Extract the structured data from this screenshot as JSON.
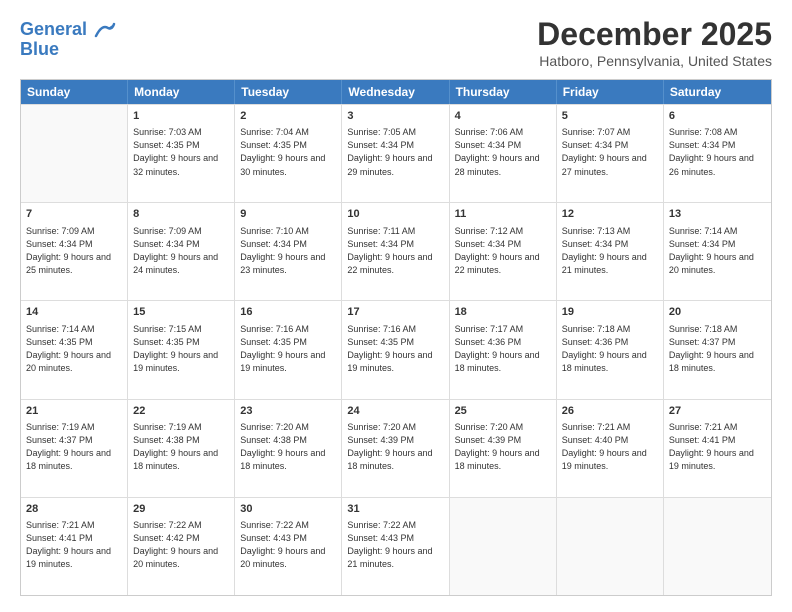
{
  "header": {
    "logo_line1": "General",
    "logo_line2": "Blue",
    "title": "December 2025",
    "subtitle": "Hatboro, Pennsylvania, United States"
  },
  "calendar": {
    "days_of_week": [
      "Sunday",
      "Monday",
      "Tuesday",
      "Wednesday",
      "Thursday",
      "Friday",
      "Saturday"
    ],
    "weeks": [
      [
        {
          "day": "",
          "sunrise": "",
          "sunset": "",
          "daylight": "",
          "empty": true
        },
        {
          "day": "1",
          "sunrise": "Sunrise: 7:03 AM",
          "sunset": "Sunset: 4:35 PM",
          "daylight": "Daylight: 9 hours and 32 minutes.",
          "empty": false
        },
        {
          "day": "2",
          "sunrise": "Sunrise: 7:04 AM",
          "sunset": "Sunset: 4:35 PM",
          "daylight": "Daylight: 9 hours and 30 minutes.",
          "empty": false
        },
        {
          "day": "3",
          "sunrise": "Sunrise: 7:05 AM",
          "sunset": "Sunset: 4:34 PM",
          "daylight": "Daylight: 9 hours and 29 minutes.",
          "empty": false
        },
        {
          "day": "4",
          "sunrise": "Sunrise: 7:06 AM",
          "sunset": "Sunset: 4:34 PM",
          "daylight": "Daylight: 9 hours and 28 minutes.",
          "empty": false
        },
        {
          "day": "5",
          "sunrise": "Sunrise: 7:07 AM",
          "sunset": "Sunset: 4:34 PM",
          "daylight": "Daylight: 9 hours and 27 minutes.",
          "empty": false
        },
        {
          "day": "6",
          "sunrise": "Sunrise: 7:08 AM",
          "sunset": "Sunset: 4:34 PM",
          "daylight": "Daylight: 9 hours and 26 minutes.",
          "empty": false
        }
      ],
      [
        {
          "day": "7",
          "sunrise": "Sunrise: 7:09 AM",
          "sunset": "Sunset: 4:34 PM",
          "daylight": "Daylight: 9 hours and 25 minutes.",
          "empty": false
        },
        {
          "day": "8",
          "sunrise": "Sunrise: 7:09 AM",
          "sunset": "Sunset: 4:34 PM",
          "daylight": "Daylight: 9 hours and 24 minutes.",
          "empty": false
        },
        {
          "day": "9",
          "sunrise": "Sunrise: 7:10 AM",
          "sunset": "Sunset: 4:34 PM",
          "daylight": "Daylight: 9 hours and 23 minutes.",
          "empty": false
        },
        {
          "day": "10",
          "sunrise": "Sunrise: 7:11 AM",
          "sunset": "Sunset: 4:34 PM",
          "daylight": "Daylight: 9 hours and 22 minutes.",
          "empty": false
        },
        {
          "day": "11",
          "sunrise": "Sunrise: 7:12 AM",
          "sunset": "Sunset: 4:34 PM",
          "daylight": "Daylight: 9 hours and 22 minutes.",
          "empty": false
        },
        {
          "day": "12",
          "sunrise": "Sunrise: 7:13 AM",
          "sunset": "Sunset: 4:34 PM",
          "daylight": "Daylight: 9 hours and 21 minutes.",
          "empty": false
        },
        {
          "day": "13",
          "sunrise": "Sunrise: 7:14 AM",
          "sunset": "Sunset: 4:34 PM",
          "daylight": "Daylight: 9 hours and 20 minutes.",
          "empty": false
        }
      ],
      [
        {
          "day": "14",
          "sunrise": "Sunrise: 7:14 AM",
          "sunset": "Sunset: 4:35 PM",
          "daylight": "Daylight: 9 hours and 20 minutes.",
          "empty": false
        },
        {
          "day": "15",
          "sunrise": "Sunrise: 7:15 AM",
          "sunset": "Sunset: 4:35 PM",
          "daylight": "Daylight: 9 hours and 19 minutes.",
          "empty": false
        },
        {
          "day": "16",
          "sunrise": "Sunrise: 7:16 AM",
          "sunset": "Sunset: 4:35 PM",
          "daylight": "Daylight: 9 hours and 19 minutes.",
          "empty": false
        },
        {
          "day": "17",
          "sunrise": "Sunrise: 7:16 AM",
          "sunset": "Sunset: 4:35 PM",
          "daylight": "Daylight: 9 hours and 19 minutes.",
          "empty": false
        },
        {
          "day": "18",
          "sunrise": "Sunrise: 7:17 AM",
          "sunset": "Sunset: 4:36 PM",
          "daylight": "Daylight: 9 hours and 18 minutes.",
          "empty": false
        },
        {
          "day": "19",
          "sunrise": "Sunrise: 7:18 AM",
          "sunset": "Sunset: 4:36 PM",
          "daylight": "Daylight: 9 hours and 18 minutes.",
          "empty": false
        },
        {
          "day": "20",
          "sunrise": "Sunrise: 7:18 AM",
          "sunset": "Sunset: 4:37 PM",
          "daylight": "Daylight: 9 hours and 18 minutes.",
          "empty": false
        }
      ],
      [
        {
          "day": "21",
          "sunrise": "Sunrise: 7:19 AM",
          "sunset": "Sunset: 4:37 PM",
          "daylight": "Daylight: 9 hours and 18 minutes.",
          "empty": false
        },
        {
          "day": "22",
          "sunrise": "Sunrise: 7:19 AM",
          "sunset": "Sunset: 4:38 PM",
          "daylight": "Daylight: 9 hours and 18 minutes.",
          "empty": false
        },
        {
          "day": "23",
          "sunrise": "Sunrise: 7:20 AM",
          "sunset": "Sunset: 4:38 PM",
          "daylight": "Daylight: 9 hours and 18 minutes.",
          "empty": false
        },
        {
          "day": "24",
          "sunrise": "Sunrise: 7:20 AM",
          "sunset": "Sunset: 4:39 PM",
          "daylight": "Daylight: 9 hours and 18 minutes.",
          "empty": false
        },
        {
          "day": "25",
          "sunrise": "Sunrise: 7:20 AM",
          "sunset": "Sunset: 4:39 PM",
          "daylight": "Daylight: 9 hours and 18 minutes.",
          "empty": false
        },
        {
          "day": "26",
          "sunrise": "Sunrise: 7:21 AM",
          "sunset": "Sunset: 4:40 PM",
          "daylight": "Daylight: 9 hours and 19 minutes.",
          "empty": false
        },
        {
          "day": "27",
          "sunrise": "Sunrise: 7:21 AM",
          "sunset": "Sunset: 4:41 PM",
          "daylight": "Daylight: 9 hours and 19 minutes.",
          "empty": false
        }
      ],
      [
        {
          "day": "28",
          "sunrise": "Sunrise: 7:21 AM",
          "sunset": "Sunset: 4:41 PM",
          "daylight": "Daylight: 9 hours and 19 minutes.",
          "empty": false
        },
        {
          "day": "29",
          "sunrise": "Sunrise: 7:22 AM",
          "sunset": "Sunset: 4:42 PM",
          "daylight": "Daylight: 9 hours and 20 minutes.",
          "empty": false
        },
        {
          "day": "30",
          "sunrise": "Sunrise: 7:22 AM",
          "sunset": "Sunset: 4:43 PM",
          "daylight": "Daylight: 9 hours and 20 minutes.",
          "empty": false
        },
        {
          "day": "31",
          "sunrise": "Sunrise: 7:22 AM",
          "sunset": "Sunset: 4:43 PM",
          "daylight": "Daylight: 9 hours and 21 minutes.",
          "empty": false
        },
        {
          "day": "",
          "sunrise": "",
          "sunset": "",
          "daylight": "",
          "empty": true
        },
        {
          "day": "",
          "sunrise": "",
          "sunset": "",
          "daylight": "",
          "empty": true
        },
        {
          "day": "",
          "sunrise": "",
          "sunset": "",
          "daylight": "",
          "empty": true
        }
      ]
    ]
  }
}
